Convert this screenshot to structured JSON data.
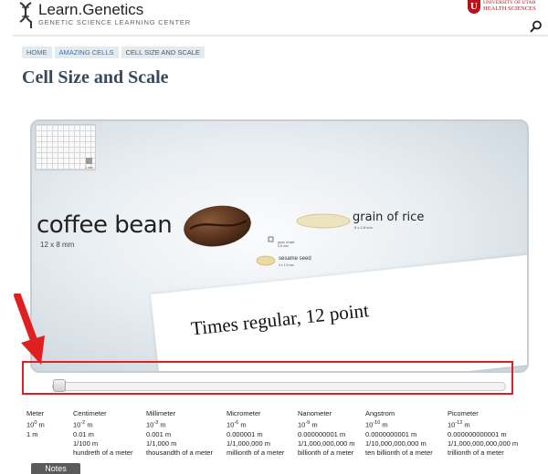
{
  "header": {
    "site_name": "Learn.Genetics",
    "site_subtitle": "GENETIC SCIENCE LEARNING CENTER",
    "university_line1": "UNIVERSITY OF UTAH",
    "university_line2": "HEALTH SCIENCES",
    "university_badge": "U",
    "search_icon": "search-icon"
  },
  "breadcrumb": [
    {
      "label": "HOME"
    },
    {
      "label": "AMAZING CELLS"
    },
    {
      "label": "CELL SIZE AND SCALE"
    }
  ],
  "page_title": "Cell Size and Scale",
  "stage": {
    "grid_label": "1 mm",
    "objects": {
      "coffee_bean": {
        "label": "coffee bean",
        "size": "12 x 8 mm"
      },
      "rice": {
        "label": "grain of rice",
        "size": "8 x 2.8 mm"
      },
      "small_item": {
        "label": "grain of salt",
        "size": "0.5 mm"
      },
      "sesame": {
        "label": "sesame seed",
        "size": "3 x 1.5 mm"
      }
    },
    "paper_text": "Times regular, 12 point",
    "slider_position": 0.0
  },
  "units": [
    {
      "name": "Meter",
      "base": "10",
      "exp": "0",
      "unit": "m",
      "decimal": "1 m",
      "fraction": "",
      "description": ""
    },
    {
      "name": "Centimeter",
      "base": "10",
      "exp": "-2",
      "unit": "m",
      "decimal": "0.01 m",
      "fraction": "1/100 m",
      "description": "hundreth of a meter"
    },
    {
      "name": "Millimeter",
      "base": "10",
      "exp": "-3",
      "unit": "m",
      "decimal": "0.001 m",
      "fraction": "1/1,000 m",
      "description": "thousandth of a meter"
    },
    {
      "name": "Micrometer",
      "base": "10",
      "exp": "-6",
      "unit": "m",
      "decimal": "0.000001 m",
      "fraction": "1/1,000,000 m",
      "description": "millionth of a meter"
    },
    {
      "name": "Nanometer",
      "base": "10",
      "exp": "-9",
      "unit": "m",
      "decimal": "0.000000001 m",
      "fraction": "1/1,000,000,000 m",
      "description": "billionth of a meter"
    },
    {
      "name": "Angstrom",
      "base": "10",
      "exp": "-10",
      "unit": "m",
      "decimal": "0.0000000001 m",
      "fraction": "1/10,000,000,000 m",
      "description": "ten billionth of a meter"
    },
    {
      "name": "Picometer",
      "base": "10",
      "exp": "-12",
      "unit": "m",
      "decimal": "0.000000000001 m",
      "fraction": "1/1,000,000,000,000 m",
      "description": "trillionth of a meter"
    }
  ],
  "notes_tab": "Notes",
  "colors": {
    "annotation": "#e02020",
    "title": "#374a5c",
    "breadcrumb_bg": "#e3ebf1",
    "university": "#b5121b"
  }
}
